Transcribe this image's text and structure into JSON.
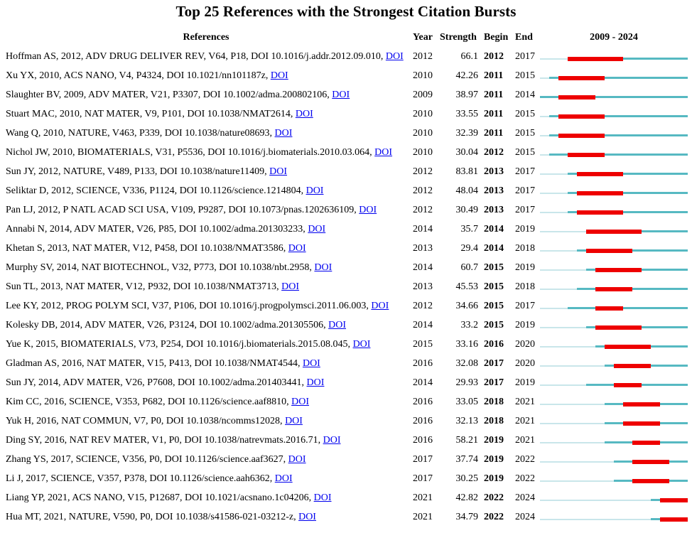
{
  "title": "Top 25 References with the Strongest Citation Bursts",
  "headers": {
    "references": "References",
    "year": "Year",
    "strength": "Strength",
    "begin": "Begin",
    "end": "End",
    "range": "2009 - 2024"
  },
  "link_text": "DOI",
  "colors": {
    "pre": "#c9e6ea",
    "post": "#56b9c2",
    "burst": "#ee0000",
    "link": "#0000ee"
  },
  "chart_data": {
    "type": "table",
    "range": [
      2009,
      2024
    ],
    "columns": [
      "References",
      "Year",
      "Strength",
      "Begin",
      "End",
      "2009 - 2024"
    ],
    "rows": [
      {
        "ref": "Hoffman AS, 2012, ADV DRUG DELIVER REV, V64, P18, DOI 10.1016/j.addr.2012.09.010,",
        "year": 2012,
        "strength": "66.1",
        "begin": 2012,
        "end": 2017
      },
      {
        "ref": "Xu YX, 2010, ACS NANO, V4, P4324, DOI 10.1021/nn101187z,",
        "year": 2010,
        "strength": "42.26",
        "begin": 2011,
        "end": 2015
      },
      {
        "ref": "Slaughter BV, 2009, ADV MATER, V21, P3307, DOI 10.1002/adma.200802106,",
        "year": 2009,
        "strength": "38.97",
        "begin": 2011,
        "end": 2014
      },
      {
        "ref": "Stuart MAC, 2010, NAT MATER, V9, P101, DOI 10.1038/NMAT2614,",
        "year": 2010,
        "strength": "33.55",
        "begin": 2011,
        "end": 2015
      },
      {
        "ref": "Wang Q, 2010, NATURE, V463, P339, DOI 10.1038/nature08693,",
        "year": 2010,
        "strength": "32.39",
        "begin": 2011,
        "end": 2015
      },
      {
        "ref": "Nichol JW, 2010, BIOMATERIALS, V31, P5536, DOI 10.1016/j.biomaterials.2010.03.064,",
        "year": 2010,
        "strength": "30.04",
        "begin": 2012,
        "end": 2015
      },
      {
        "ref": "Sun JY, 2012, NATURE, V489, P133, DOI 10.1038/nature11409,",
        "year": 2012,
        "strength": "83.81",
        "begin": 2013,
        "end": 2017
      },
      {
        "ref": "Seliktar D, 2012, SCIENCE, V336, P1124, DOI 10.1126/science.1214804,",
        "year": 2012,
        "strength": "48.04",
        "begin": 2013,
        "end": 2017
      },
      {
        "ref": "Pan LJ, 2012, P NATL ACAD SCI USA, V109, P9287, DOI 10.1073/pnas.1202636109,",
        "year": 2012,
        "strength": "30.49",
        "begin": 2013,
        "end": 2017
      },
      {
        "ref": "Annabi N, 2014, ADV MATER, V26, P85, DOI 10.1002/adma.201303233,",
        "year": 2014,
        "strength": "35.7",
        "begin": 2014,
        "end": 2019
      },
      {
        "ref": "Khetan S, 2013, NAT MATER, V12, P458, DOI 10.1038/NMAT3586,",
        "year": 2013,
        "strength": "29.4",
        "begin": 2014,
        "end": 2018
      },
      {
        "ref": "Murphy SV, 2014, NAT BIOTECHNOL, V32, P773, DOI 10.1038/nbt.2958,",
        "year": 2014,
        "strength": "60.7",
        "begin": 2015,
        "end": 2019
      },
      {
        "ref": "Sun TL, 2013, NAT MATER, V12, P932, DOI 10.1038/NMAT3713,",
        "year": 2013,
        "strength": "45.53",
        "begin": 2015,
        "end": 2018
      },
      {
        "ref": "Lee KY, 2012, PROG POLYM SCI, V37, P106, DOI 10.1016/j.progpolymsci.2011.06.003,",
        "year": 2012,
        "strength": "34.66",
        "begin": 2015,
        "end": 2017
      },
      {
        "ref": "Kolesky DB, 2014, ADV MATER, V26, P3124, DOI 10.1002/adma.201305506,",
        "year": 2014,
        "strength": "33.2",
        "begin": 2015,
        "end": 2019
      },
      {
        "ref": "Yue K, 2015, BIOMATERIALS, V73, P254, DOI 10.1016/j.biomaterials.2015.08.045,",
        "year": 2015,
        "strength": "33.16",
        "begin": 2016,
        "end": 2020
      },
      {
        "ref": "Gladman AS, 2016, NAT MATER, V15, P413, DOI 10.1038/NMAT4544,",
        "year": 2016,
        "strength": "32.08",
        "begin": 2017,
        "end": 2020
      },
      {
        "ref": "Sun JY, 2014, ADV MATER, V26, P7608, DOI 10.1002/adma.201403441,",
        "year": 2014,
        "strength": "29.93",
        "begin": 2017,
        "end": 2019
      },
      {
        "ref": "Kim CC, 2016, SCIENCE, V353, P682, DOI 10.1126/science.aaf8810,",
        "year": 2016,
        "strength": "33.05",
        "begin": 2018,
        "end": 2021
      },
      {
        "ref": "Yuk H, 2016, NAT COMMUN, V7, P0, DOI 10.1038/ncomms12028,",
        "year": 2016,
        "strength": "32.13",
        "begin": 2018,
        "end": 2021
      },
      {
        "ref": "Ding SY, 2016, NAT REV MATER, V1, P0, DOI 10.1038/natrevmats.2016.71,",
        "year": 2016,
        "strength": "58.21",
        "begin": 2019,
        "end": 2021
      },
      {
        "ref": "Zhang YS, 2017, SCIENCE, V356, P0, DOI 10.1126/science.aaf3627,",
        "year": 2017,
        "strength": "37.74",
        "begin": 2019,
        "end": 2022
      },
      {
        "ref": "Li J, 2017, SCIENCE, V357, P378, DOI 10.1126/science.aah6362,",
        "year": 2017,
        "strength": "30.25",
        "begin": 2019,
        "end": 2022
      },
      {
        "ref": "Liang YP, 2021, ACS NANO, V15, P12687, DOI 10.1021/acsnano.1c04206,",
        "year": 2021,
        "strength": "42.82",
        "begin": 2022,
        "end": 2024
      },
      {
        "ref": "Hua MT, 2021, NATURE, V590, P0, DOI 10.1038/s41586-021-03212-z,",
        "year": 2021,
        "strength": "34.79",
        "begin": 2022,
        "end": 2024
      }
    ]
  }
}
